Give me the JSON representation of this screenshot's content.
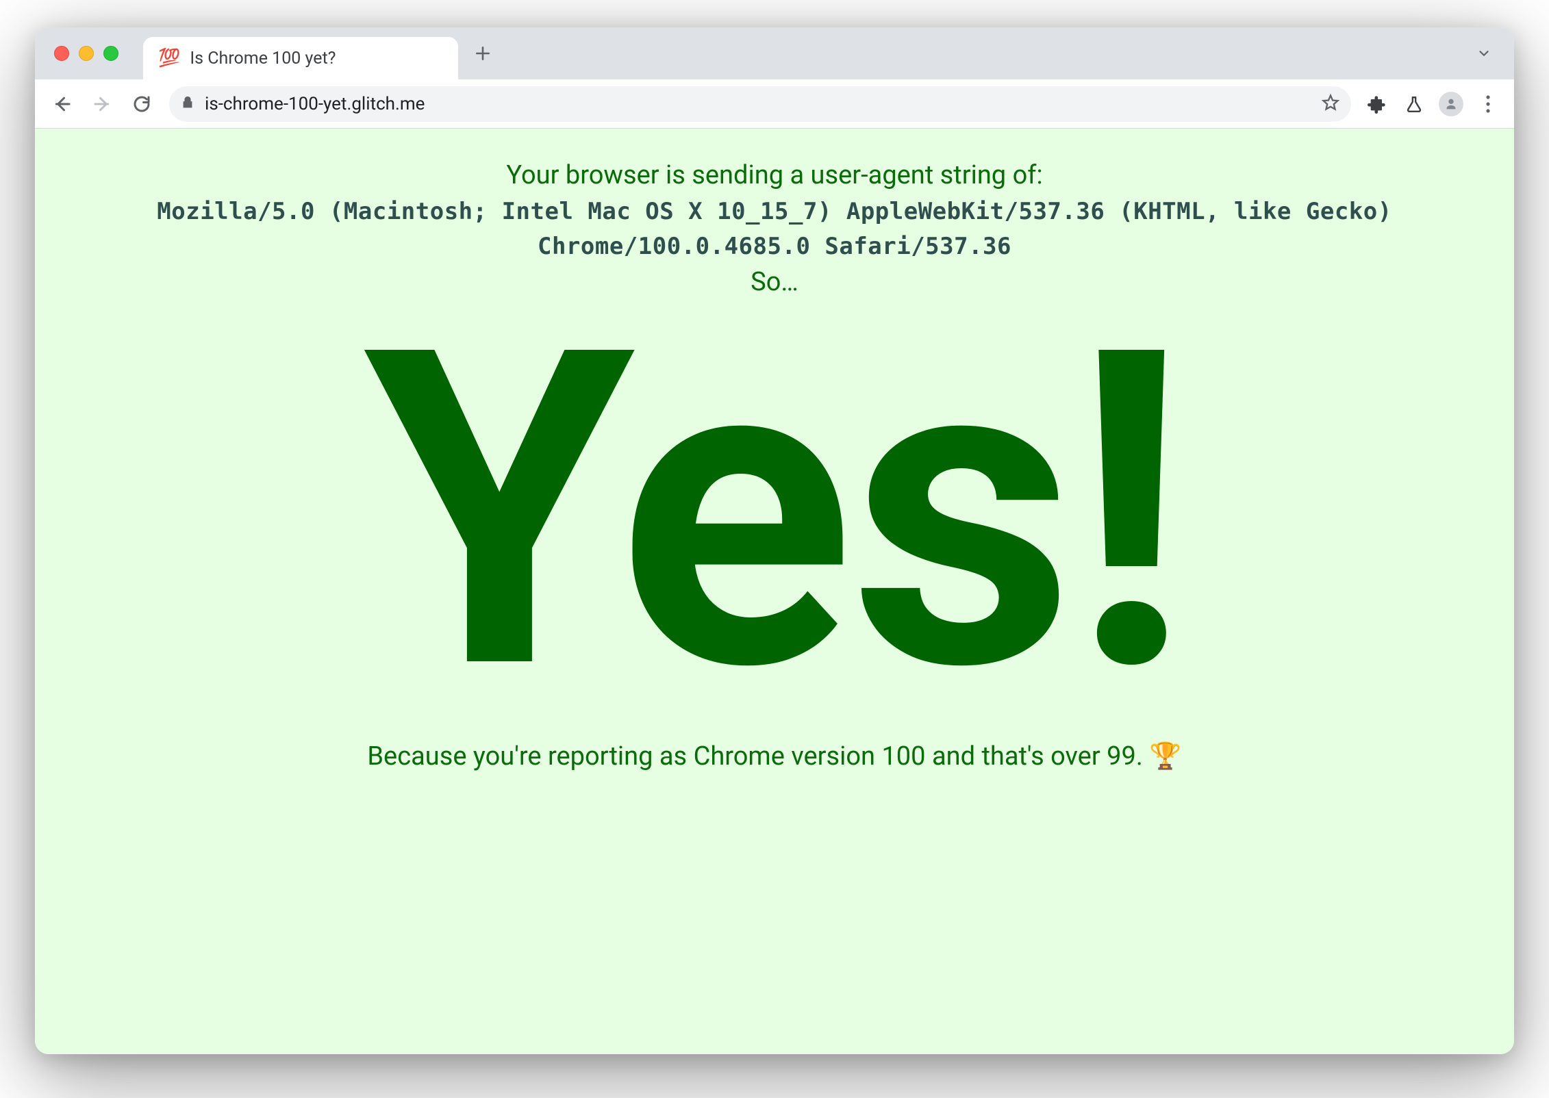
{
  "window": {
    "tab": {
      "favicon": "💯",
      "title": "Is Chrome 100 yet?"
    }
  },
  "toolbar": {
    "url": "is-chrome-100-yet.glitch.me"
  },
  "page": {
    "intro": "Your browser is sending a user-agent string of:",
    "user_agent": "Mozilla/5.0 (Macintosh; Intel Mac OS X 10_15_7) AppleWebKit/537.36 (KHTML, like Gecko) Chrome/100.0.4685.0 Safari/537.36",
    "so": "So…",
    "answer": "Yes!",
    "reason": "Because you're reporting as Chrome version 100 and that's over 99. 🏆"
  }
}
